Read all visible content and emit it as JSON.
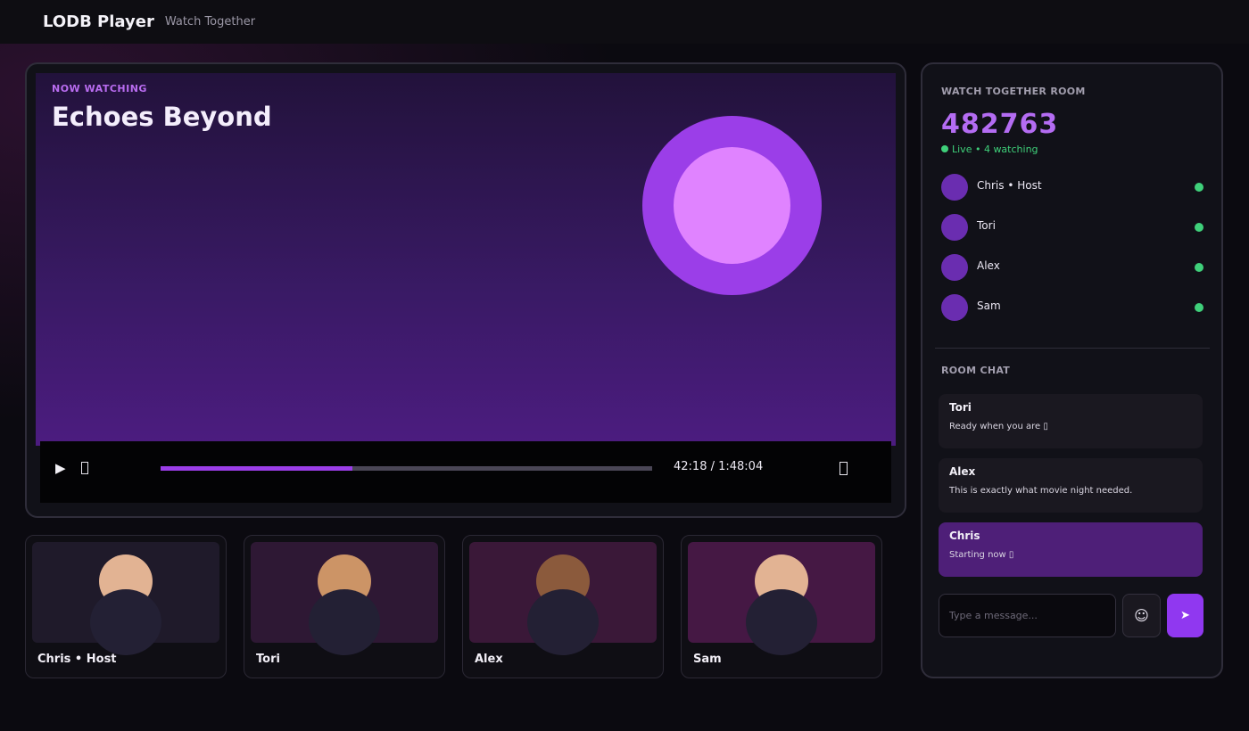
{
  "header": {
    "title": "LODB Player",
    "subtitle": "Watch Together"
  },
  "player": {
    "now_watching_label": "NOW WATCHING",
    "movie_title": "Echoes Beyond",
    "controls": {
      "play_icon": "▶",
      "time_display": "42:18 / 1:48:04",
      "progress_fraction": 0.39
    }
  },
  "participants": [
    {
      "name": "Chris • Host",
      "skin": "#e2b393",
      "cam_bg": "#1f1a2a"
    },
    {
      "name": "Tori",
      "skin": "#cc9466",
      "cam_bg": "#2e1834"
    },
    {
      "name": "Alex",
      "skin": "#8b5a3c",
      "cam_bg": "#3a1838"
    },
    {
      "name": "Sam",
      "skin": "#e2b393",
      "cam_bg": "#451844"
    }
  ],
  "room": {
    "label": "WATCH TOGETHER ROOM",
    "code": "482763",
    "status": "Live  •  4 watching",
    "members": [
      "Chris • Host",
      "Tori",
      "Alex",
      "Sam"
    ]
  },
  "chat": {
    "label": "ROOM CHAT",
    "messages": [
      {
        "author": "Tori",
        "text": "Ready when you are ▯",
        "mine": false
      },
      {
        "author": "Alex",
        "text": "This is exactly what movie night needed.",
        "mine": false
      },
      {
        "author": "Chris",
        "text": "Starting now ▯",
        "mine": true
      }
    ],
    "input_placeholder": "Type a message...",
    "emoji_icon": "☺",
    "send_icon": "➤"
  },
  "colors": {
    "accent": "#9b3ee8",
    "live": "#3fd07a",
    "room_code": "#b46cf2"
  }
}
